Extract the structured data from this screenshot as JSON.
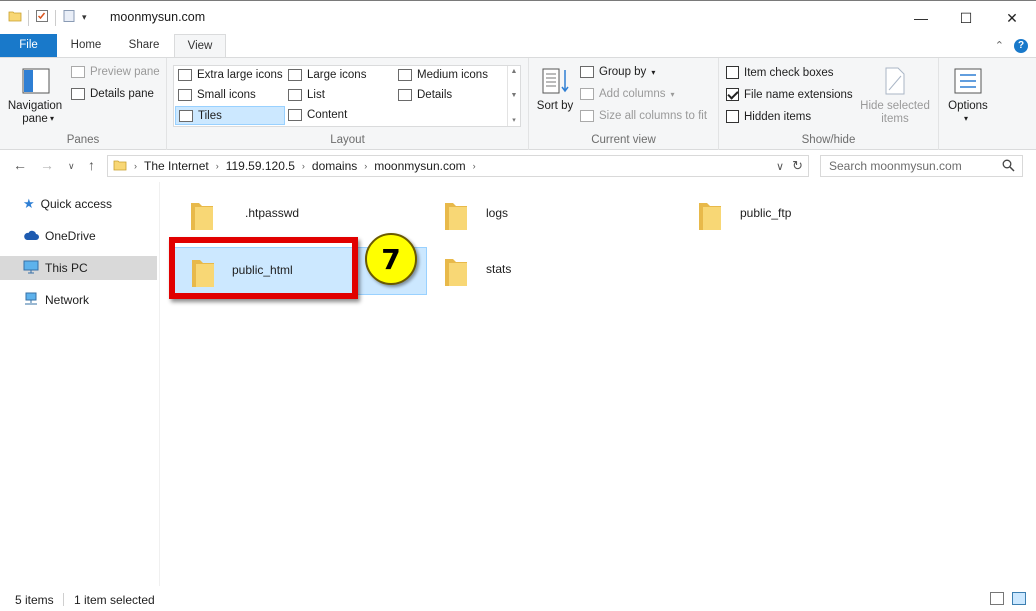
{
  "window": {
    "title": "moonmysun.com",
    "minimize_icon": "—",
    "maximize_icon": "☐",
    "close_icon": "✕"
  },
  "ribbon_tabs": {
    "file": "File",
    "home": "Home",
    "share": "Share",
    "view": "View",
    "expand_icon": "⌃",
    "help": "?"
  },
  "panes": {
    "navigation_pane": "Navigation pane",
    "preview_pane": "Preview pane",
    "details_pane": "Details pane",
    "label": "Panes"
  },
  "layout": {
    "extra_large_icons": "Extra large icons",
    "large_icons": "Large icons",
    "medium_icons": "Medium icons",
    "small_icons": "Small icons",
    "list": "List",
    "details": "Details",
    "tiles": "Tiles",
    "content": "Content",
    "label": "Layout",
    "selected": "Tiles"
  },
  "current_view": {
    "sort_by": "Sort by",
    "group_by": "Group by",
    "add_columns": "Add columns",
    "size_all_columns": "Size all columns to fit",
    "label": "Current view"
  },
  "show_hide": {
    "item_check_boxes": "Item check boxes",
    "item_check_boxes_checked": false,
    "file_name_extensions": "File name extensions",
    "file_name_extensions_checked": true,
    "hidden_items": "Hidden items",
    "hidden_items_checked": false,
    "hide_selected_items": "Hide selected items",
    "label": "Show/hide"
  },
  "options": {
    "label": "Options"
  },
  "address": {
    "breadcrumbs": [
      "The Internet",
      "119.59.120.5",
      "domains",
      "moonmysun.com"
    ],
    "search_placeholder": "Search moonmysun.com"
  },
  "nav_pane": {
    "items": [
      "Quick access",
      "OneDrive",
      "This PC",
      "Network"
    ],
    "selected": "This PC"
  },
  "files": [
    {
      "name": ".htpasswd",
      "selected": false
    },
    {
      "name": "logs",
      "selected": false
    },
    {
      "name": "public_ftp",
      "selected": false
    },
    {
      "name": "public_html",
      "selected": true
    },
    {
      "name": "stats",
      "selected": false
    }
  ],
  "annotation": {
    "step_number": "7"
  },
  "status": {
    "item_count": "5 items",
    "selection": "1 item selected"
  },
  "colors": {
    "accent": "#1979ca",
    "selection_bg": "#cce8ff",
    "selection_border": "#99d1ff",
    "annotation_red": "#e10000",
    "annotation_yellow": "#ffff00",
    "folder_yellow": "#f8d775"
  }
}
